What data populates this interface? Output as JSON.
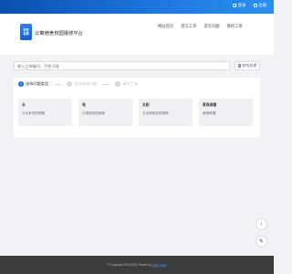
{
  "topbar": {
    "login_label": "登录",
    "register_label": "注册"
  },
  "header": {
    "logo_line1": "学校",
    "logo_line2": "名称",
    "site_title": "公寓宿舍校园报修平台"
  },
  "nav": {
    "items": [
      {
        "label": "网站首页"
      },
      {
        "label": "提交工单"
      },
      {
        "label": "常见问题"
      },
      {
        "label": "我的工单"
      }
    ]
  },
  "search": {
    "placeholder": "输入工单编号、手机号查",
    "button_label": "查找结果"
  },
  "steps": [
    {
      "num": "1",
      "label": "选择问题类型"
    },
    {
      "num": "2",
      "label": "选择具体问题"
    },
    {
      "num": "3",
      "label": "填写工单"
    }
  ],
  "cards": [
    {
      "title": "水",
      "desc": "与水有关的报修"
    },
    {
      "title": "电",
      "desc": "与电相关的报修"
    },
    {
      "title": "太阳",
      "desc": "与太阳相关的报修"
    },
    {
      "title": "家具修理",
      "desc": "家具修理"
    }
  ],
  "float": {
    "up_glyph": "↑",
    "edit_glyph": "✎"
  },
  "footer": {
    "text": "© Copyright 2015-2024. Power by",
    "link": "运维工程师"
  },
  "colors": {
    "brand": "#1e6fd9",
    "topbar": "#1f78e0",
    "footer": "#3c3c3c"
  }
}
